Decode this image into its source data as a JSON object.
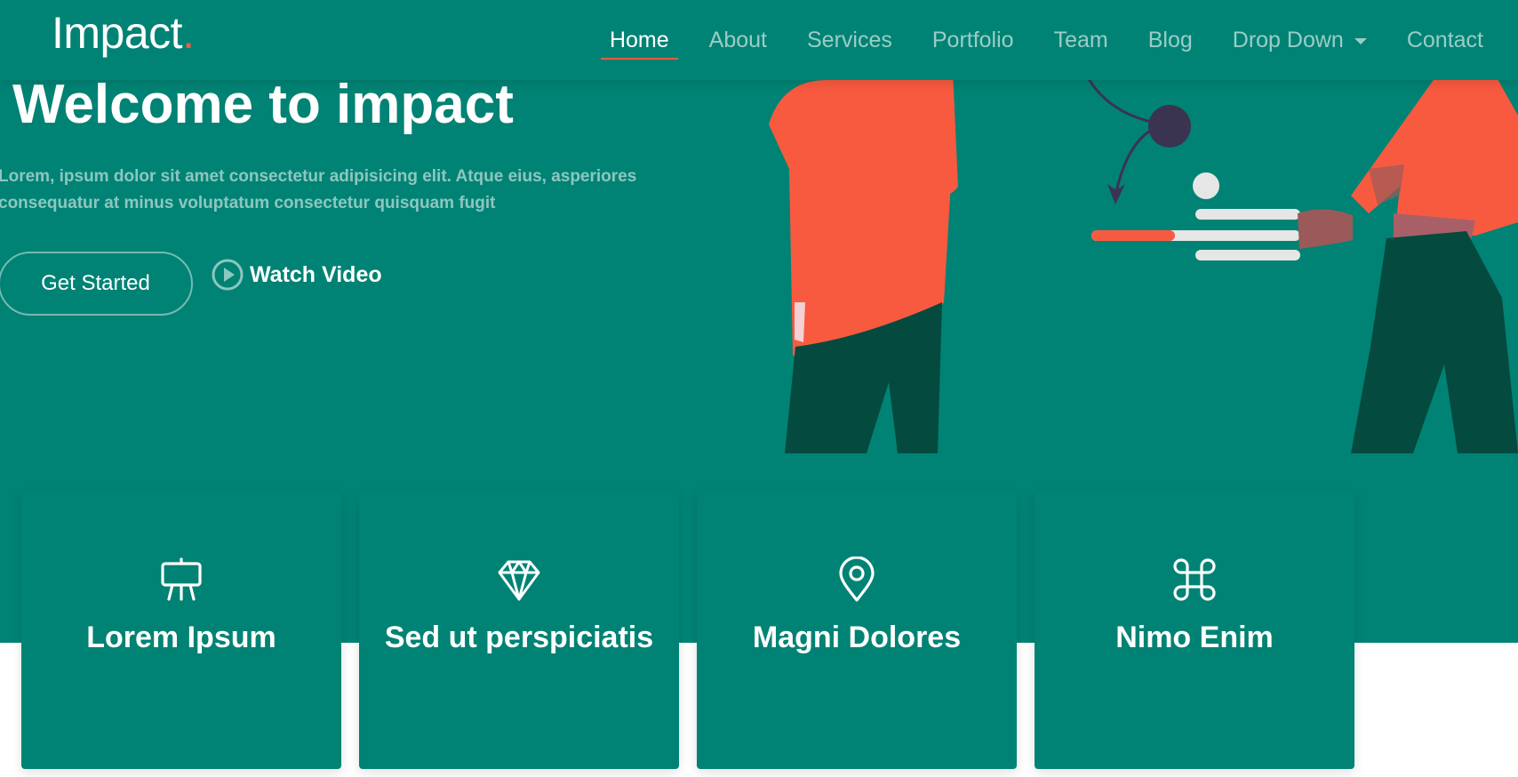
{
  "brand": {
    "name": "Impact",
    "dot": "."
  },
  "nav": {
    "items": [
      {
        "label": "Home"
      },
      {
        "label": "About"
      },
      {
        "label": "Services"
      },
      {
        "label": "Portfolio"
      },
      {
        "label": "Team"
      },
      {
        "label": "Blog"
      },
      {
        "label": "Drop Down"
      },
      {
        "label": "Contact"
      }
    ],
    "active": "Home"
  },
  "hero": {
    "title": "Welcome to impact",
    "text": "Lorem, ipsum dolor sit amet consectetur adipisicing elit. Atque eius, asperiores consequatur at minus voluptatum consectetur quisquam fugit",
    "primary_button": "Get Started",
    "video_button": "Watch Video"
  },
  "cards": [
    {
      "title": "Lorem Ipsum",
      "icon": "easel-icon"
    },
    {
      "title": "Sed ut perspiciatis",
      "icon": "gem-icon"
    },
    {
      "title": "Magni Dolores",
      "icon": "geo-pin-icon"
    },
    {
      "title": "Nimo Enim",
      "icon": "command-icon"
    }
  ],
  "colors": {
    "primary": "#008374",
    "accent": "#f85a40",
    "dark_green": "#054a3f",
    "navy": "#3a3451",
    "white": "#ffffff"
  }
}
